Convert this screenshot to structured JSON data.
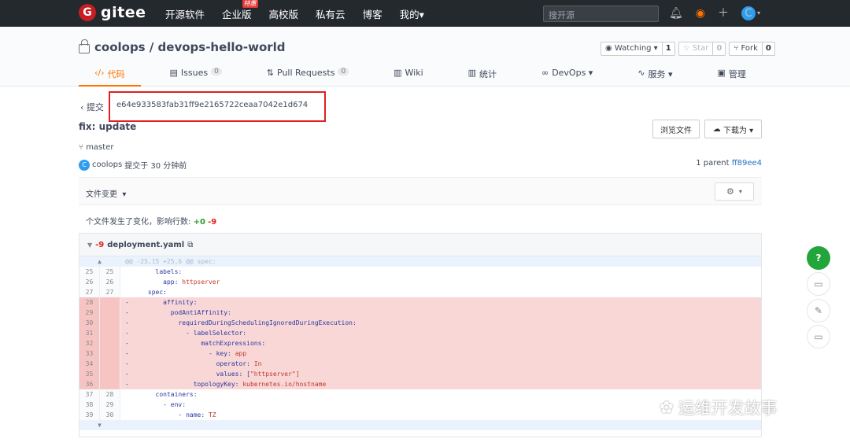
{
  "topbar": {
    "logo": "gitee",
    "logo_mark": "G",
    "nav": [
      "开源软件",
      "企业版",
      "高校版",
      "私有云",
      "博客",
      "我的▾"
    ],
    "badge": "特惠",
    "search_placeholder": "搜开源",
    "avatar": "C"
  },
  "repo": {
    "title": "coolops / devops-hello-world",
    "watch_label": "Watching ▾",
    "watch_count": "1",
    "star_label": "☆ Star",
    "star_count": "0",
    "fork_label": "Fork",
    "fork_count": "0"
  },
  "tabs": [
    {
      "label": "代码",
      "icon": "code-icon"
    },
    {
      "label": "Issues",
      "count": "0"
    },
    {
      "label": "Pull Requests",
      "count": "0"
    },
    {
      "label": "Wiki"
    },
    {
      "label": "统计"
    },
    {
      "label": "DevOps ▾"
    },
    {
      "label": "服务 ▾"
    },
    {
      "label": "管理"
    }
  ],
  "commit": {
    "back_label": "提交",
    "hash": "e64e933583fab31ff9e2165722ceaa7042e1d674",
    "title": "fix: update",
    "browse_button": "浏览文件",
    "download_button": "下载为 ▾",
    "branch": "master",
    "author": "coolops",
    "author_initial": "C",
    "time": "提交于 30 分钟前",
    "parent_label": "1 parent",
    "parent_hash": "ff89ee4"
  },
  "file_changes": {
    "label": "文件变更",
    "summary_prefix": "个文件发生了变化，影响行数:",
    "plus": "+0",
    "minus": "-9"
  },
  "diff": {
    "stat": "-9",
    "filename": "deployment.yaml",
    "hunk": "@@ -25,15 +25,6 @@ spec:",
    "lines": [
      {
        "old": "25",
        "new": "25",
        "type": "ctx",
        "pre": "        labels:",
        "val": ""
      },
      {
        "old": "26",
        "new": "26",
        "type": "ctx",
        "pre": "          app: ",
        "val": "httpserver"
      },
      {
        "old": "27",
        "new": "27",
        "type": "ctx",
        "pre": "      spec:",
        "val": ""
      },
      {
        "old": "28",
        "new": "",
        "type": "del",
        "pre": "-         affinity:",
        "val": ""
      },
      {
        "old": "29",
        "new": "",
        "type": "del",
        "pre": "-           podAntiAffinity:",
        "val": ""
      },
      {
        "old": "30",
        "new": "",
        "type": "del",
        "pre": "-             requiredDuringSchedulingIgnoredDuringExecution:",
        "val": ""
      },
      {
        "old": "31",
        "new": "",
        "type": "del",
        "pre": "-               - labelSelector:",
        "val": ""
      },
      {
        "old": "32",
        "new": "",
        "type": "del",
        "pre": "-                   matchExpressions:",
        "val": ""
      },
      {
        "old": "33",
        "new": "",
        "type": "del",
        "pre": "-                     - key: ",
        "val": "app"
      },
      {
        "old": "34",
        "new": "",
        "type": "del",
        "pre": "-                       operator: ",
        "val": "In"
      },
      {
        "old": "35",
        "new": "",
        "type": "del",
        "pre": "-                       values: [",
        "val": "\"httpserver\"]"
      },
      {
        "old": "36",
        "new": "",
        "type": "del",
        "pre": "-                 topologyKey: ",
        "val": "kubernetes.io/hostname"
      },
      {
        "old": "37",
        "new": "28",
        "type": "ctx",
        "pre": "        containers:",
        "val": ""
      },
      {
        "old": "38",
        "new": "29",
        "type": "ctx",
        "pre": "          - env:",
        "val": ""
      },
      {
        "old": "39",
        "new": "30",
        "type": "ctx",
        "pre": "              - name: ",
        "val": "TZ"
      }
    ]
  },
  "floating": {
    "help": "?"
  },
  "watermark": "运维开发故事"
}
